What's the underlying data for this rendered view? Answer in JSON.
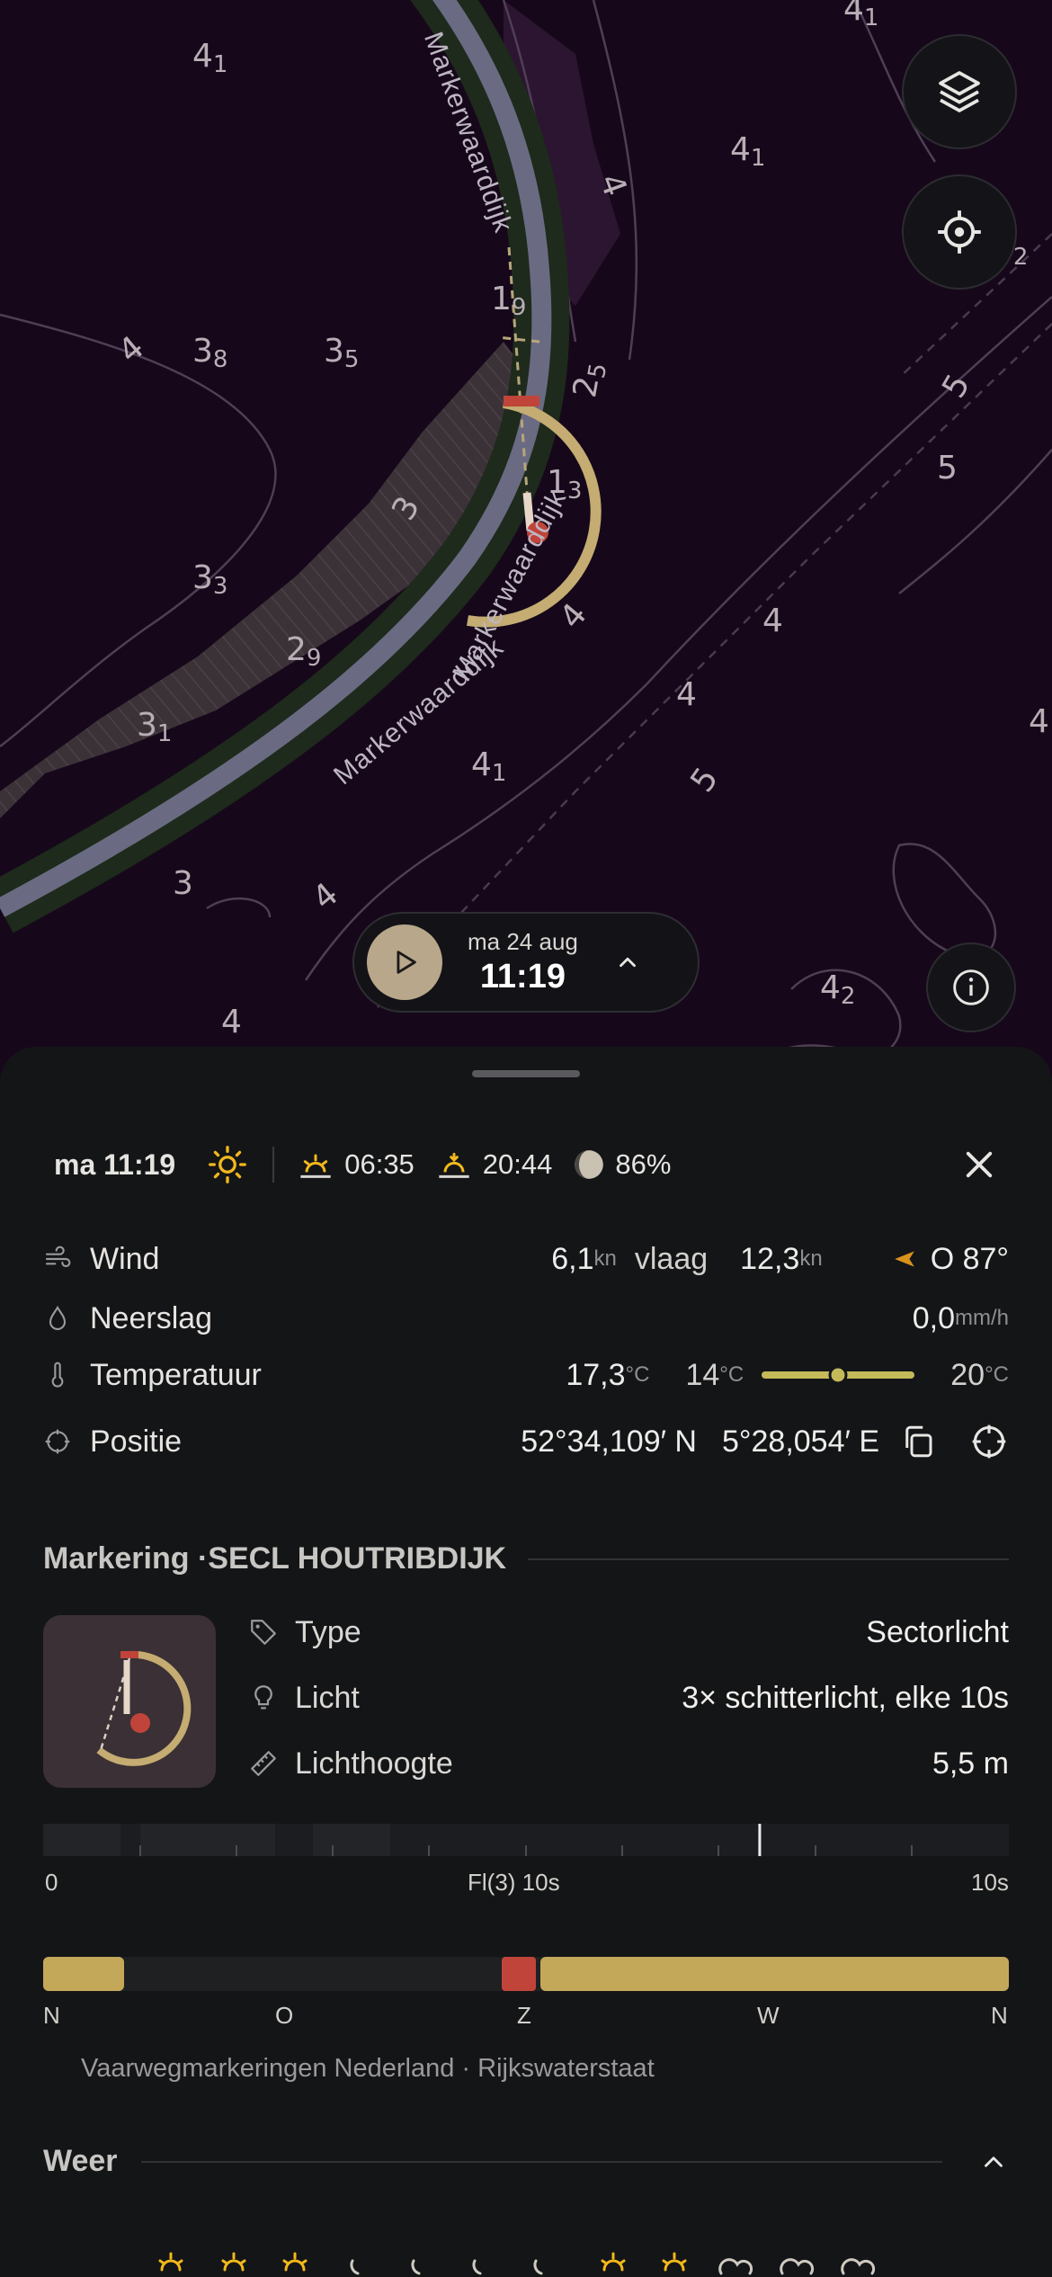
{
  "map": {
    "road_labels": [
      "Markerwaarddijk",
      "Markerwaarddijk",
      "Markerwaarddijk"
    ],
    "depths": [
      {
        "main": "4",
        "sub": "1"
      },
      {
        "main": "4",
        "sub": "1"
      },
      {
        "main": "4",
        "sub": "1"
      },
      {
        "main": "3",
        "sub": "8"
      },
      {
        "main": "3",
        "sub": "5"
      },
      {
        "main": "4",
        "sub": ""
      },
      {
        "main": "1",
        "sub": "9"
      },
      {
        "main": "2",
        "sub": "5"
      },
      {
        "main": "1",
        "sub": "3"
      },
      {
        "main": "3",
        "sub": ""
      },
      {
        "main": "5",
        "sub": ""
      },
      {
        "main": "5",
        "sub": ""
      },
      {
        "main": "3",
        "sub": "3"
      },
      {
        "main": "2",
        "sub": "9"
      },
      {
        "main": "4",
        "sub": ""
      },
      {
        "main": "4",
        "sub": ""
      },
      {
        "main": "4",
        "sub": ""
      },
      {
        "main": "3",
        "sub": "1"
      },
      {
        "main": "4",
        "sub": "1"
      },
      {
        "main": "5",
        "sub": ""
      },
      {
        "main": "3",
        "sub": ""
      },
      {
        "main": "4",
        "sub": ""
      },
      {
        "main": "4",
        "sub": "2"
      },
      {
        "main": "4",
        "sub": ""
      },
      {
        "main": "4",
        "sub": ""
      },
      {
        "main": "4",
        "sub": "2"
      },
      {
        "main": "4",
        "sub": ""
      }
    ],
    "layers_icon": "layers-icon",
    "locate_icon": "crosshair-icon",
    "info_icon": "info-icon"
  },
  "time_pill": {
    "date": "ma 24 aug",
    "time": "11:19"
  },
  "summary": {
    "day_time": "ma 11:19",
    "sunrise": "06:35",
    "sunset": "20:44",
    "moon": "86%"
  },
  "weather": {
    "wind_label": "Wind",
    "wind_speed": "6,1",
    "wind_unit": "kn",
    "gust_label": "vlaag",
    "gust_speed": "12,3",
    "gust_unit": "kn",
    "wind_dir": "O 87°",
    "rain_label": "Neerslag",
    "rain_value": "0,0",
    "rain_unit": "mm/h",
    "temp_label": "Temperatuur",
    "temp_value": "17,3",
    "temp_min": "14",
    "temp_max": "20",
    "temp_unit": "°C",
    "temp_fraction": 0.5,
    "pos_label": "Positie",
    "lat": "52°34,109′ N",
    "lon": "5°28,054′ E"
  },
  "marker": {
    "section_prefix": "Markering · ",
    "name": "SECL HOUTRIBDIJK",
    "type_label": "Type",
    "type_value": "Sectorlicht",
    "light_label": "Licht",
    "light_value": "3× schitterlicht, elke 10s",
    "height_label": "Lichthoogte",
    "height_value": "5,5 m",
    "timeline_start": "0",
    "timeline_mid": "Fl(3) 10s",
    "timeline_end": "10s",
    "timeline_cursor_fraction": 0.742,
    "sector_labels": [
      "N",
      "O",
      "Z",
      "W",
      "N"
    ],
    "sector_colors": {
      "yellow": "#c4a85a",
      "red": "#c0443a"
    },
    "source": "Vaarwegmarkeringen Nederland · Rijkswaterstaat"
  },
  "weer": {
    "title": "Weer"
  },
  "colors": {
    "accent": "#c4a85a",
    "sun": "#f2b81c",
    "red": "#c0443a"
  }
}
